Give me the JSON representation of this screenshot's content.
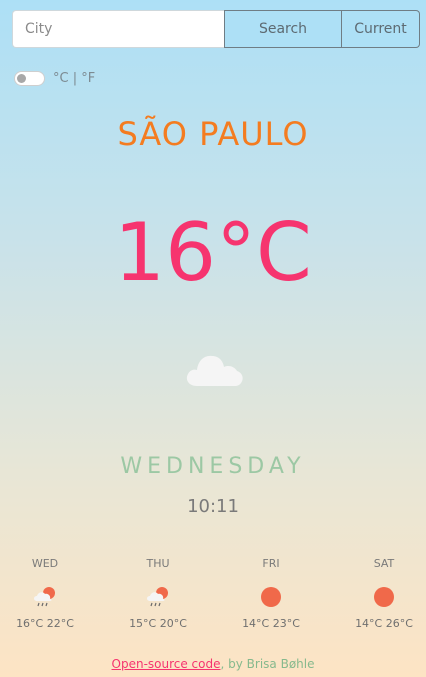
{
  "search": {
    "placeholder": "City",
    "search_label": "Search",
    "current_label": "Current"
  },
  "units": {
    "label": "°C | °F",
    "selected": "°C"
  },
  "location": {
    "city": "SÃO PAULO"
  },
  "current": {
    "temperature": "16°C",
    "condition_icon": "cloud-icon"
  },
  "time": {
    "weekday": "WEDNESDAY",
    "clock": "10:11"
  },
  "forecast": [
    {
      "day": "WED",
      "icon": "rain-sun-icon",
      "range": "16°C 22°C"
    },
    {
      "day": "THU",
      "icon": "rain-sun-icon",
      "range": "15°C 20°C"
    },
    {
      "day": "FRI",
      "icon": "sun-icon",
      "range": "14°C 23°C"
    },
    {
      "day": "SAT",
      "icon": "sun-icon",
      "range": "14°C 26°C"
    }
  ],
  "footer": {
    "link_text": "Open-source code",
    "suffix": ", by Brisa Bøhle"
  },
  "colors": {
    "city": "#f47c20",
    "temperature": "#f6346f",
    "weekday": "#9cc8a4",
    "sun": "#f0694a",
    "cloud": "#f5f5f5"
  }
}
